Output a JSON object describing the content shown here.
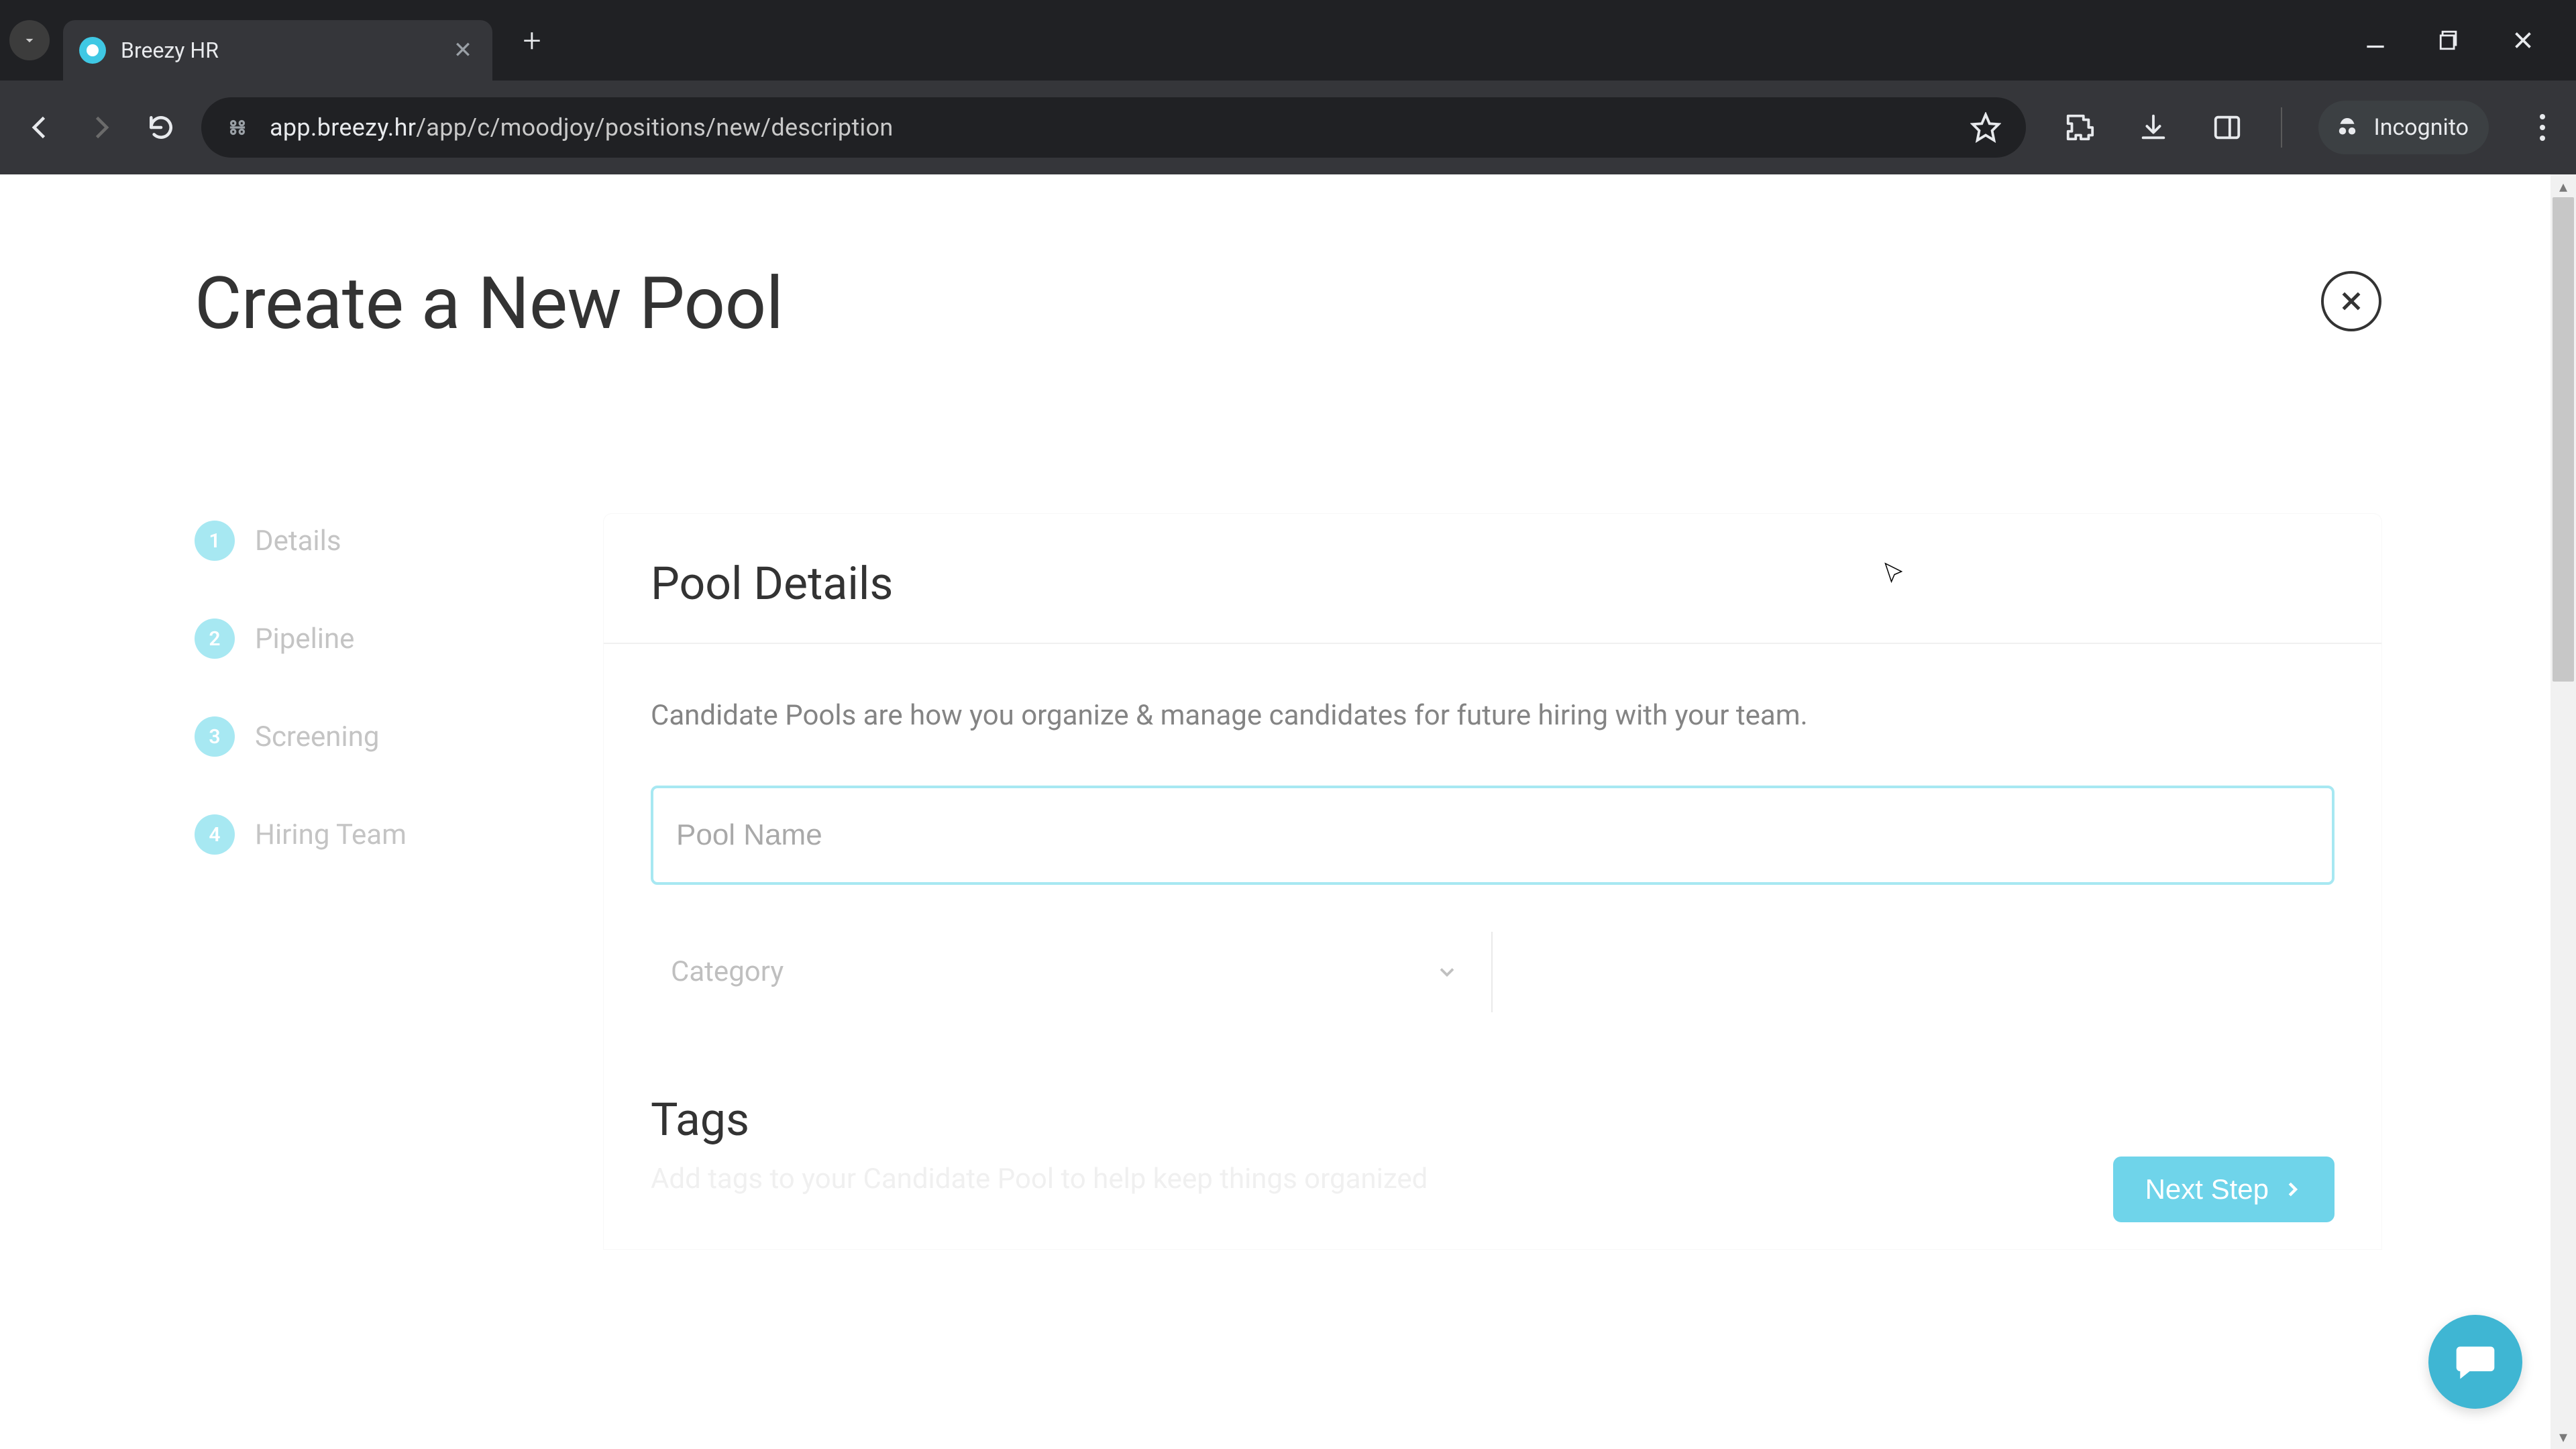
{
  "browser": {
    "tab_title": "Breezy HR",
    "url_host": "app.breezy.hr",
    "url_path": "/app/c/moodjoy/positions/new/description",
    "incognito_label": "Incognito"
  },
  "page": {
    "title": "Create a New Pool",
    "steps": [
      {
        "num": "1",
        "label": "Details"
      },
      {
        "num": "2",
        "label": "Pipeline"
      },
      {
        "num": "3",
        "label": "Screening"
      },
      {
        "num": "4",
        "label": "Hiring Team"
      }
    ],
    "panel": {
      "section_title": "Pool Details",
      "description": "Candidate Pools are how you organize & manage candidates for future hiring with your team.",
      "pool_name_placeholder": "Pool Name",
      "category_placeholder": "Category",
      "tags_title": "Tags",
      "tags_description": "Add tags to your Candidate Pool to help keep things organized",
      "next_label": "Next Step"
    }
  }
}
